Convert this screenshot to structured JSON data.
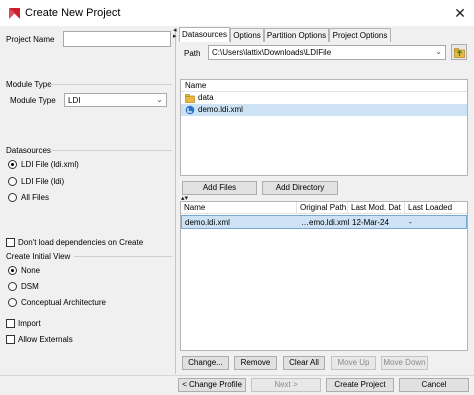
{
  "window": {
    "title": "Create New Project"
  },
  "left": {
    "project_name_label": "Project Name",
    "project_name_value": "",
    "module_type_section": "Module Type",
    "module_type_label": "Module Type",
    "module_type_value": "LDI",
    "datasources_section": "Datasources",
    "datasource_options": [
      "LDI File (ldi.xml)",
      "LDI File (ldi)",
      "All Files"
    ],
    "datasource_selected": 0,
    "dont_load_label": "Don't load dependencies on Create",
    "initial_view_section": "Create Initial View",
    "view_options": [
      "None",
      "DSM",
      "Conceptual Architecture"
    ],
    "view_selected": 0,
    "import_label": "Import",
    "allow_externals_label": "Allow Externals"
  },
  "tabs": [
    "Datasources",
    "Options",
    "Partition Options",
    "Project Options"
  ],
  "active_tab": 0,
  "datasources": {
    "path_label": "Path",
    "path_value": "C:\\Users\\lattix\\Downloads\\LDIFile",
    "browser_header": "Name",
    "browser_items": [
      {
        "name": "data",
        "icon": "folder-icon"
      },
      {
        "name": "demo.ldi.xml",
        "icon": "file-icon",
        "selected": true
      }
    ],
    "add_files_label": "Add Files",
    "add_directory_label": "Add Directory",
    "table_headers": [
      "Name",
      "Original Path",
      "Last Mod. Dat",
      "Last Loaded"
    ],
    "table_rows": [
      [
        "demo.ldi.xml",
        "…emo.ldi.xml",
        "12-Mar-24",
        "-"
      ]
    ],
    "change_label": "Change...",
    "remove_label": "Remove",
    "clear_all_label": "Clear All",
    "move_up_label": "Move Up",
    "move_down_label": "Move Down"
  },
  "footer": {
    "change_profile_label": "< Change Profile",
    "next_label": "Next >",
    "create_project_label": "Create Project",
    "cancel_label": "Cancel"
  },
  "colors": {
    "accent": "#cc1f2d",
    "selection": "#cde3f5",
    "folder": "#e8b840",
    "file": "#2b72c9"
  }
}
